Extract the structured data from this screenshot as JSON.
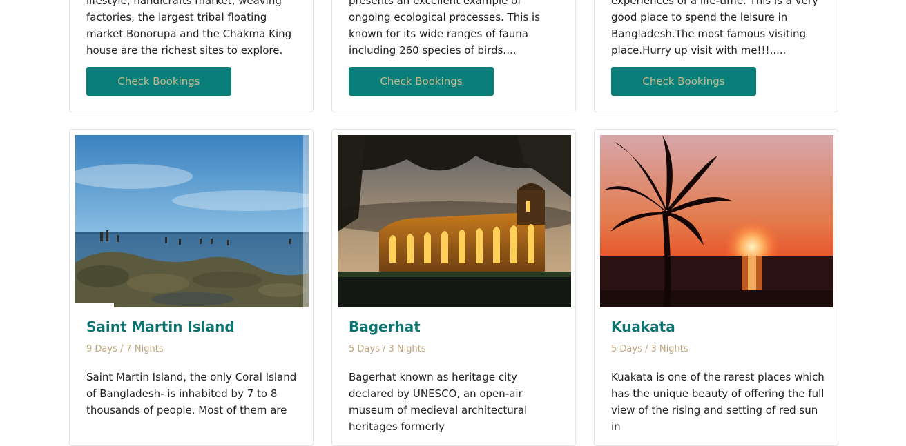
{
  "top_cards": [
    {
      "desc": "lifestyle, handicrafts market, weaving factories, the largest tribal floating market Bonorupa and the Chakma King house are the richest sites to explore.",
      "button": "Check Bookings"
    },
    {
      "desc": "presents an excellent example of ongoing ecological processes. This is known for its wide ranges of fauna including 260 species of birds....",
      "button": "Check Bookings"
    },
    {
      "desc": "experiences of a life-time. This is a very good place to spend the leisure in Bangladesh.The most famous visiting place.Hurry up visit with me!!!.....",
      "button": "Check Bookings"
    }
  ],
  "cards": [
    {
      "title": "Saint Martin Island",
      "duration": "9 Days / 7 Nights",
      "desc": "Saint Martin Island, the only Coral Island of Bangladesh- is inhabited by 7 to 8 thousands of people. Most of them are"
    },
    {
      "title": "Bagerhat",
      "duration": "5 Days / 3 Nights",
      "desc": "Bagerhat known as heritage city declared by UNESCO, an open-air museum of medieval architectural heritages formerly"
    },
    {
      "title": "Kuakata",
      "duration": "5 Days / 3 Nights",
      "desc": "Kuakata is one of the rarest places which has the unique beauty of offering the full view of the rising and setting of red sun in"
    }
  ],
  "colors": {
    "accent": "#0a7f7a",
    "button_text": "#c9b98a",
    "title": "#0a7470",
    "duration": "#c0a57a"
  }
}
